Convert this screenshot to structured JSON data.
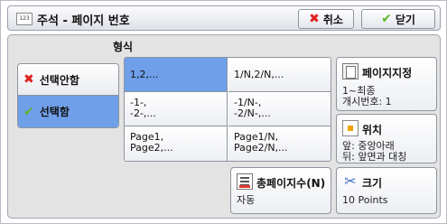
{
  "header": {
    "icon_text": "123",
    "title": "주석 - 페이지 번호",
    "cancel_label": "취소",
    "close_label": "닫기"
  },
  "format_label": "형식",
  "toggle": {
    "off_label": "선택안함",
    "on_label": "선택함",
    "selected": "on"
  },
  "formats": [
    [
      "1,2,..."
    ],
    [
      "1/N,2/N,..."
    ],
    [
      "-1-,",
      "-2-,..."
    ],
    [
      "-1/N-,",
      "-2/N-,..."
    ],
    [
      "Page1,",
      "Page2,..."
    ],
    [
      "Page1/N,",
      "Page2/N,..."
    ]
  ],
  "selected_format_index": 0,
  "start_page": {
    "title": "페이지지정",
    "line1": "1~최종",
    "line2": "개시번호: 1"
  },
  "position": {
    "title": "위치",
    "line1": "앞: 중앙아래",
    "line2": "뒤: 앞면과 대칭"
  },
  "total_pages": {
    "title": "총페이지수(N)",
    "value": "자동"
  },
  "size": {
    "title": "크기",
    "value": "10 Points"
  },
  "colors": {
    "selected": "#6f9fe9",
    "cancel_x": "#e02020",
    "check": "#5cb82a"
  }
}
